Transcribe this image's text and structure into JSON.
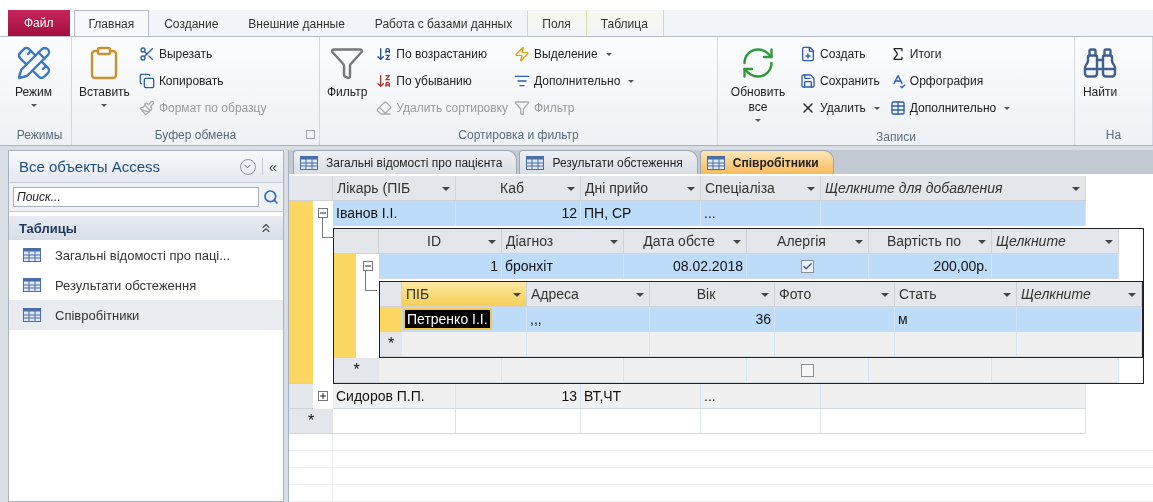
{
  "file_tab": "Файл",
  "ribbon_tabs": [
    {
      "label": "Главная",
      "selected": true,
      "contextual": false
    },
    {
      "label": "Создание",
      "selected": false,
      "contextual": false
    },
    {
      "label": "Внешние данные",
      "selected": false,
      "contextual": false
    },
    {
      "label": "Работа с базами данных",
      "selected": false,
      "contextual": false
    },
    {
      "label": "Поля",
      "selected": false,
      "contextual": true
    },
    {
      "label": "Таблица",
      "selected": false,
      "contextual": true
    }
  ],
  "ribbon_groups": [
    {
      "label": "Режимы",
      "launcher": false,
      "items": [
        {
          "kind": "large",
          "label": "Режим",
          "dropdown": true
        }
      ]
    },
    {
      "label": "Буфер обмена",
      "launcher": true,
      "items": [
        {
          "kind": "large",
          "label": "Вставить",
          "dropdown": true
        },
        {
          "kind": "column",
          "items": [
            {
              "label": "Вырезать",
              "disabled": false,
              "dropdown": false
            },
            {
              "label": "Копировать",
              "disabled": false,
              "dropdown": false
            },
            {
              "label": "Формат по образцу",
              "disabled": true,
              "dropdown": false
            }
          ]
        }
      ]
    },
    {
      "label": "Сортировка и фильтр",
      "launcher": false,
      "items": [
        {
          "kind": "large",
          "label": "Фильтр",
          "dropdown": false
        },
        {
          "kind": "column",
          "items": [
            {
              "label": "По возрастанию",
              "disabled": false,
              "dropdown": false
            },
            {
              "label": "По убыванию",
              "disabled": false,
              "dropdown": false
            },
            {
              "label": "Удалить сортировку",
              "disabled": true,
              "dropdown": false
            }
          ]
        },
        {
          "kind": "column",
          "items": [
            {
              "label": "Выделение",
              "disabled": false,
              "dropdown": true
            },
            {
              "label": "Дополнительно",
              "disabled": false,
              "dropdown": true
            },
            {
              "label": "Фильтр",
              "disabled": true,
              "dropdown": false
            }
          ]
        }
      ]
    },
    {
      "label": "Записи",
      "launcher": false,
      "items": [
        {
          "kind": "large",
          "label": "Обновить все",
          "dropdown": true
        },
        {
          "kind": "column",
          "items": [
            {
              "label": "Создать",
              "disabled": false,
              "dropdown": false
            },
            {
              "label": "Сохранить",
              "disabled": false,
              "dropdown": false
            },
            {
              "label": "Удалить",
              "disabled": false,
              "dropdown": true
            }
          ]
        },
        {
          "kind": "column",
          "items": [
            {
              "label": "Итоги",
              "disabled": false,
              "dropdown": false
            },
            {
              "label": "Орфография",
              "disabled": false,
              "dropdown": false
            },
            {
              "label": "Дополнительно",
              "disabled": false,
              "dropdown": true
            }
          ]
        }
      ]
    },
    {
      "label": "На",
      "launcher": false,
      "items": [
        {
          "kind": "large",
          "label": "Найти",
          "dropdown": false
        }
      ]
    }
  ],
  "navigation": {
    "title": "Все объекты Access",
    "collapse": "«",
    "search_placeholder": "Поиск...",
    "section": "Таблицы",
    "items": [
      {
        "label": "Загальні відомості про паці...",
        "selected": false
      },
      {
        "label": "Результати обстеження",
        "selected": false
      },
      {
        "label": "Співробітники",
        "selected": true
      }
    ]
  },
  "document_tabs": [
    {
      "label": "Загальні відомості про пацієнта",
      "selected": false
    },
    {
      "label": "Результати обстеження",
      "selected": false
    },
    {
      "label": "Співробітники",
      "selected": true
    }
  ],
  "datasheet": {
    "columns": [
      {
        "label": "Лікарь (ПІБ",
        "kind": "text"
      },
      {
        "label": "Каб",
        "kind": "number"
      },
      {
        "label": "Дні прийо",
        "kind": "text"
      },
      {
        "label": "Спеціаліза",
        "kind": "text"
      },
      {
        "label": "Щелкните для добавления",
        "kind": "add"
      }
    ],
    "rows": [
      {
        "selected": true,
        "expanded": true,
        "cells": [
          "Іванов І.І.",
          "12",
          "ПН, СР",
          "...",
          null
        ],
        "subdatasheet": {
          "columns": [
            {
              "label": "ID",
              "kind": "number"
            },
            {
              "label": "Діагноз",
              "kind": "text"
            },
            {
              "label": "Дата обсте",
              "kind": "number"
            },
            {
              "label": "Алергія",
              "kind": "check"
            },
            {
              "label": "Вартість по",
              "kind": "number"
            },
            {
              "label": "Щелкните",
              "kind": "add"
            }
          ],
          "rows": [
            {
              "selected": true,
              "expanded": true,
              "cells": [
                "1",
                "бронхіт",
                "08.02.2018",
                true,
                "200,00р.",
                null
              ],
              "subdatasheet": {
                "columns": [
                  {
                    "label": "ПІБ",
                    "kind": "text",
                    "active": true
                  },
                  {
                    "label": "Адреса",
                    "kind": "text",
                    "active": false
                  },
                  {
                    "label": "Вік",
                    "kind": "number",
                    "active": false
                  },
                  {
                    "label": "Фото",
                    "kind": "text",
                    "active": false
                  },
                  {
                    "label": "Стать",
                    "kind": "text",
                    "active": false
                  },
                  {
                    "label": "Щелкните",
                    "kind": "add",
                    "active": false
                  }
                ],
                "rows": [
                  {
                    "selected": true,
                    "editing": true,
                    "cells": [
                      "Петренко І.І.",
                      ",,,",
                      "36",
                      null,
                      "м",
                      null
                    ]
                  }
                ],
                "new_row": {
                  "marker": "*",
                  "cells": [
                    null,
                    null,
                    null,
                    null,
                    null,
                    null
                  ]
                }
              }
            }
          ],
          "new_row": {
            "marker": "*",
            "cells": [
              null,
              null,
              null,
              false,
              null,
              null
            ]
          }
        }
      },
      {
        "selected": false,
        "expanded": false,
        "cells": [
          "Сидоров П.П.",
          "13",
          "ВТ,ЧТ",
          "...",
          null
        ]
      }
    ],
    "new_row": {
      "marker": "*",
      "cells": [
        null,
        null,
        null,
        null,
        null
      ]
    }
  }
}
